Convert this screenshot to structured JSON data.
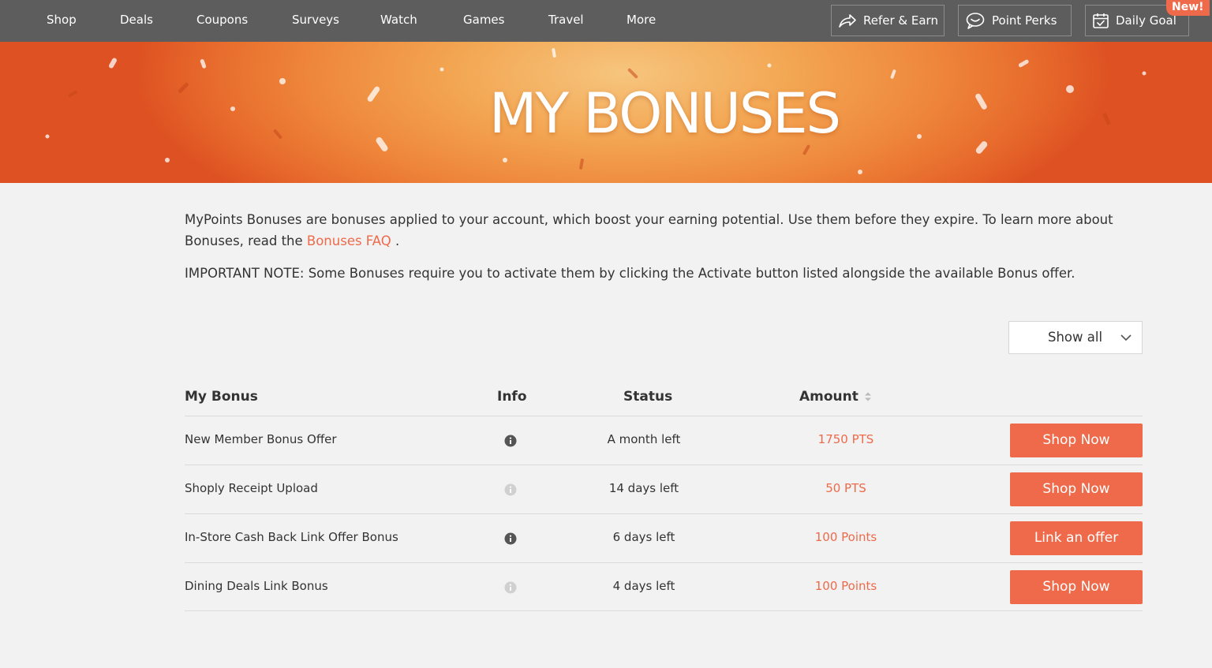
{
  "nav": {
    "links": [
      "Shop",
      "Deals",
      "Coupons",
      "Surveys",
      "Watch",
      "Games",
      "Travel",
      "More"
    ],
    "refer_label": "Refer & Earn",
    "perks_label": "Point Perks",
    "goal_label": "Daily Goal",
    "new_badge": "New!"
  },
  "hero": {
    "title": "MY BONUSES"
  },
  "intro": {
    "text_before": "MyPoints Bonuses are bonuses applied to your account, which boost your earning potential. Use them before they expire. To learn more about Bonuses, read the ",
    "faq_link": "Bonuses FAQ",
    "text_after": " .",
    "note": "IMPORTANT NOTE: Some Bonuses require you to activate them by clicking the Activate button listed alongside the available Bonus offer."
  },
  "filter": {
    "selected": "Show all"
  },
  "table": {
    "headers": {
      "bonus": "My Bonus",
      "info": "Info",
      "status": "Status",
      "amount": "Amount"
    },
    "rows": [
      {
        "name": "New Member Bonus Offer",
        "status": "A month left",
        "amount": "1750 PTS",
        "action": "Shop Now"
      },
      {
        "name": "Shoply Receipt Upload",
        "status": "14 days left",
        "amount": "50 PTS",
        "action": "Shop Now"
      },
      {
        "name": "In-Store Cash Back Link Offer Bonus",
        "status": "6 days left",
        "amount": "100 Points",
        "action": "Link an offer"
      },
      {
        "name": "Dining Deals Link Bonus",
        "status": "4 days left",
        "amount": "100 Points",
        "action": "Shop Now"
      }
    ]
  },
  "colors": {
    "nav_bg": "#5d5d5d",
    "accent": "#ee6a4a",
    "page_bg": "#f2f2f2"
  }
}
